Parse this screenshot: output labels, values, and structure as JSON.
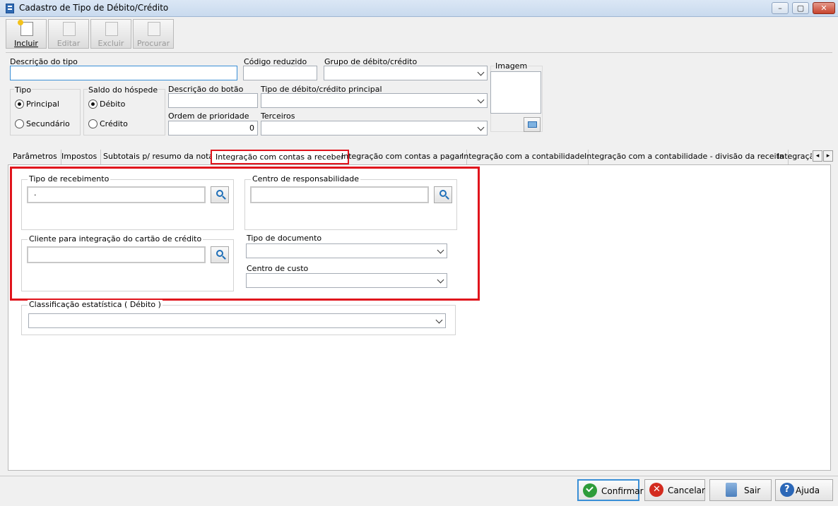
{
  "window": {
    "title": "Cadastro de Tipo de Débito/Crédito",
    "minimize": "–",
    "maximize": "▢",
    "close": "✕"
  },
  "toolbar": {
    "incluir": "Incluir",
    "editar": "Editar",
    "excluir": "Excluir",
    "procurar": "Procurar"
  },
  "form": {
    "descricao_label": "Descrição do tipo",
    "descricao_value": "",
    "codigo_label": "Código reduzido",
    "codigo_value": "",
    "grupo_label": "Grupo de débito/crédito",
    "grupo_value": "",
    "imagem_label": "Imagem",
    "tipo_label": "Tipo",
    "tipo_principal": "Principal",
    "tipo_secundario": "Secundário",
    "saldo_label": "Saldo do hóspede",
    "saldo_debito": "Débito",
    "saldo_credito": "Crédito",
    "descricao_botao_label": "Descrição do botão",
    "descricao_botao_value": "",
    "tipo_principal_label": "Tipo de débito/crédito principal",
    "tipo_principal_value": "",
    "ordem_label": "Ordem de prioridade",
    "ordem_value": "0",
    "terceiros_label": "Terceiros",
    "terceiros_value": ""
  },
  "tabs": [
    {
      "label": "Parâmetros"
    },
    {
      "label": "Impostos"
    },
    {
      "label": "Subtotais p/ resumo da nota"
    },
    {
      "label": "Integração com contas a receber"
    },
    {
      "label": "Integração com contas a pagar"
    },
    {
      "label": "Integração com a contabilidade"
    },
    {
      "label": "Integração com a contabilidade - divisão da receita"
    },
    {
      "label": "Integraçã"
    }
  ],
  "tab_nav": {
    "prev": "◂",
    "next": "▸"
  },
  "panel": {
    "tipo_recebimento_label": "Tipo de recebimento",
    "tipo_recebimento_value": ".",
    "centro_resp_label": "Centro de responsabilidade",
    "centro_resp_value": "",
    "cliente_cartao_label": "Cliente para integração do cartão de crédito",
    "cliente_cartao_value": "",
    "tipo_documento_label": "Tipo de documento",
    "tipo_documento_value": "",
    "centro_custo_label": "Centro de custo",
    "centro_custo_value": "",
    "classificacao_label": "Classificação estatística ( Débito )",
    "classificacao_value": ""
  },
  "buttons": {
    "confirmar": "Confirmar",
    "cancelar": "Cancelar",
    "sair": "Sair",
    "ajuda": "Ajuda"
  },
  "colors": {
    "highlight": "#e0141c",
    "confirm": "#2e9c3a",
    "cancel": "#d32b1f",
    "help": "#2b67b7"
  }
}
